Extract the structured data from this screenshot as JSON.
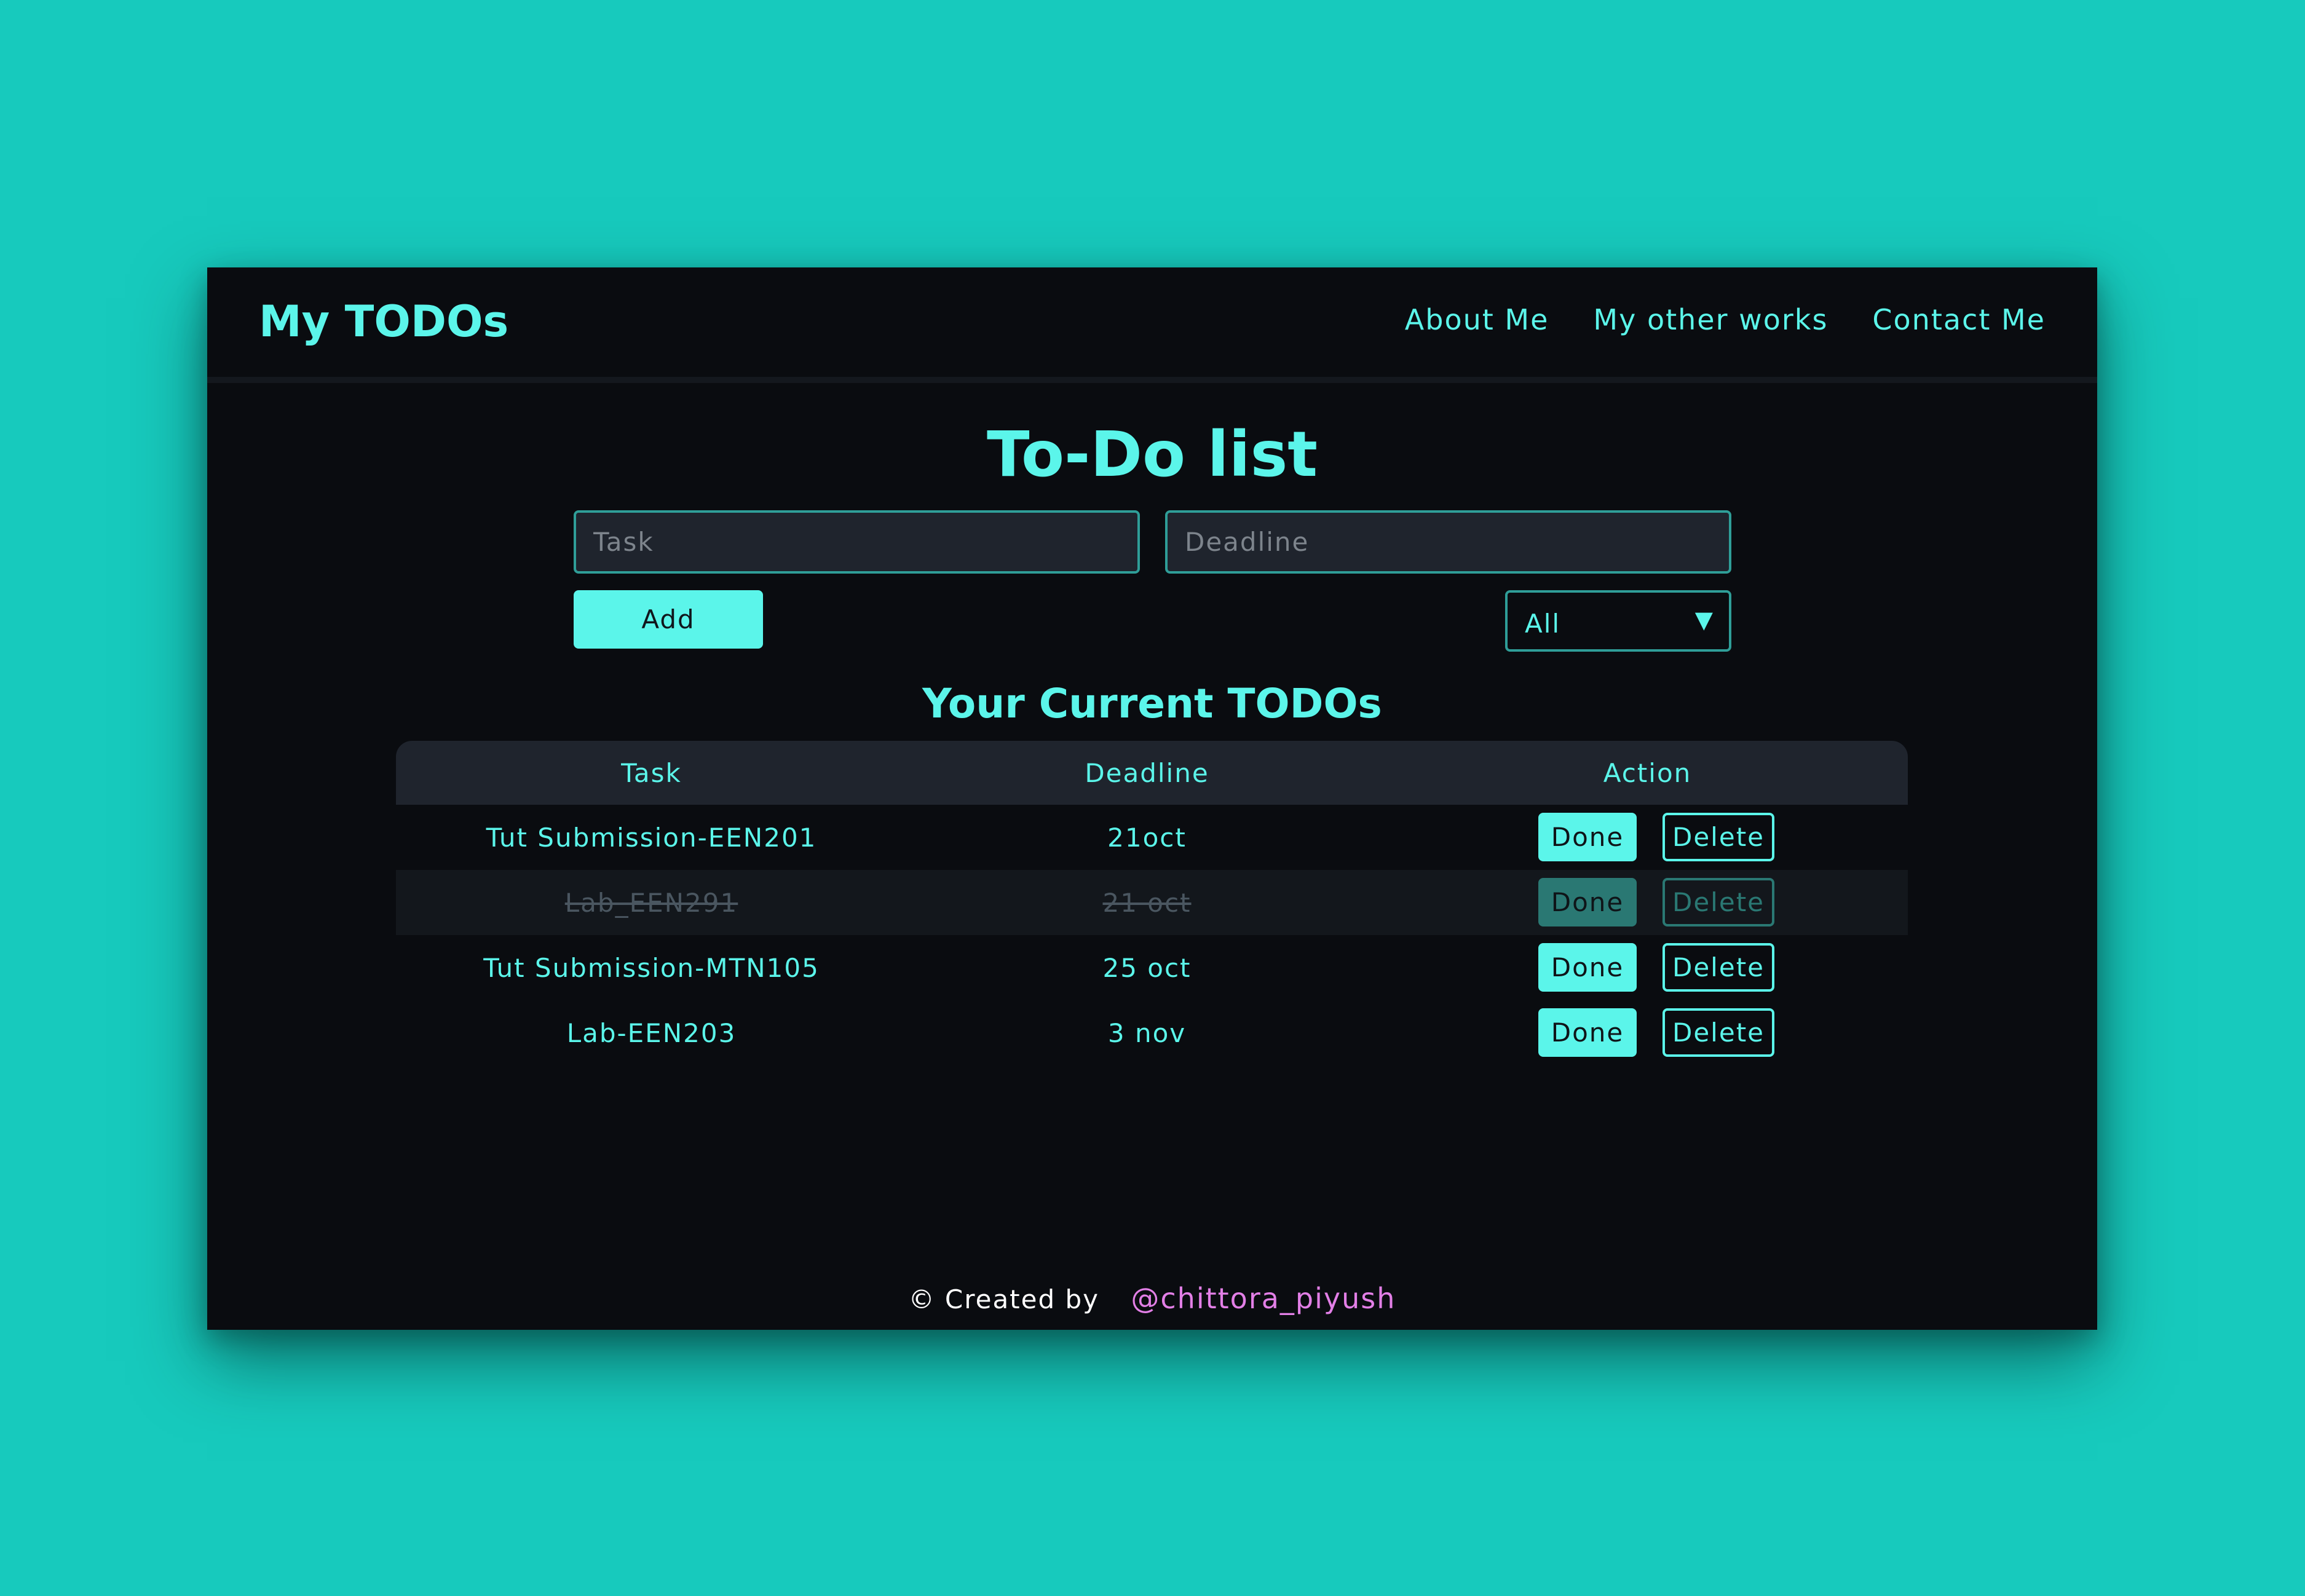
{
  "navbar": {
    "brand": "My TODOs",
    "links": [
      "About Me",
      "My other works",
      "Contact Me"
    ]
  },
  "main": {
    "title": "To-Do list",
    "task_placeholder": "Task",
    "deadline_placeholder": "Deadline",
    "task_value": "",
    "deadline_value": "",
    "add_label": "Add",
    "filter": {
      "selected": "All",
      "arrow": "▼"
    },
    "section_title": "Your Current TODOs"
  },
  "table": {
    "headers": [
      "Task",
      "Deadline",
      "Action"
    ],
    "rows": [
      {
        "task": "Tut Submission-EEN201",
        "deadline": "21oct",
        "completed": false
      },
      {
        "task": "Lab_EEN291",
        "deadline": "21 oct",
        "completed": true
      },
      {
        "task": "Tut Submission-MTN105",
        "deadline": "25 oct",
        "completed": false
      },
      {
        "task": "Lab-EEN203",
        "deadline": "3 nov",
        "completed": false
      }
    ],
    "done_label": "Done",
    "delete_label": "Delete"
  },
  "footer": {
    "text": "© Created by",
    "handle": "@chittora_piyush"
  },
  "colors": {
    "page_background": "#17cabd",
    "window_background": "#0a0c10",
    "accent": "#5bf5ea",
    "footer_handle": "#e27fe6"
  }
}
